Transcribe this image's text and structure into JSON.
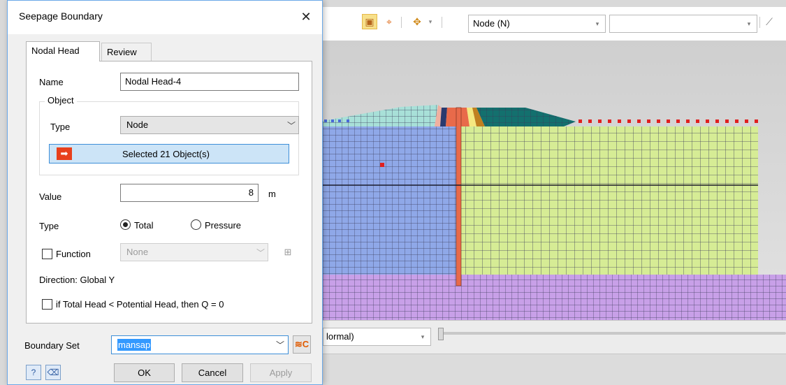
{
  "dialog": {
    "title": "Seepage Boundary",
    "close_glyph": "✕",
    "tabs": [
      {
        "label": "Nodal Head",
        "active": true
      },
      {
        "label": "Review",
        "active": false
      }
    ],
    "name_label": "Name",
    "name_value": "Nodal Head-4",
    "object_group_label": "Object",
    "object_type_label": "Type",
    "object_type_value": "Node",
    "selected_text": "Selected 21 Object(s)",
    "value_label": "Value",
    "value_value": "8",
    "value_unit": "m",
    "head_type_label": "Type",
    "head_type_options": [
      {
        "label": "Total",
        "selected": true
      },
      {
        "label": "Pressure",
        "selected": false
      }
    ],
    "function_label": "Function",
    "function_checked": false,
    "function_value": "None",
    "direction_text": "Direction: Global Y",
    "potential_head_text": "if Total Head < Potential Head, then Q = 0",
    "potential_head_checked": false,
    "boundary_set_label": "Boundary Set",
    "boundary_set_value": "mansap",
    "buttons": {
      "ok": "OK",
      "cancel": "Cancel",
      "apply": "Apply"
    }
  },
  "toolbar": {
    "selection_filter_value": "Node (N)",
    "secondary_combo_value": ""
  },
  "statusbar": {
    "view_mode_value": "lormal)"
  },
  "icons": {
    "close": "close-icon",
    "select_arrow": "arrow-right-icon",
    "function_edit": "function-graph-icon",
    "boundary_set_manager": "boundary-set-manager-icon",
    "dialog_help": "help-icon",
    "dialog_eraser": "eraser-icon"
  },
  "colors": {
    "dialog_accent": "#3c8ed8",
    "selection_highlight": "#cce4f7",
    "text_highlight": "#3399ff",
    "mesh_blue": "#8fa8e8",
    "mesh_green": "#d6ec95",
    "mesh_purple": "#c8a0e8",
    "mesh_teal": "#13706e",
    "mesh_light_teal": "#a8e0d8",
    "mesh_core_red": "#e86a4a",
    "selected_node_red": "#e02020"
  }
}
